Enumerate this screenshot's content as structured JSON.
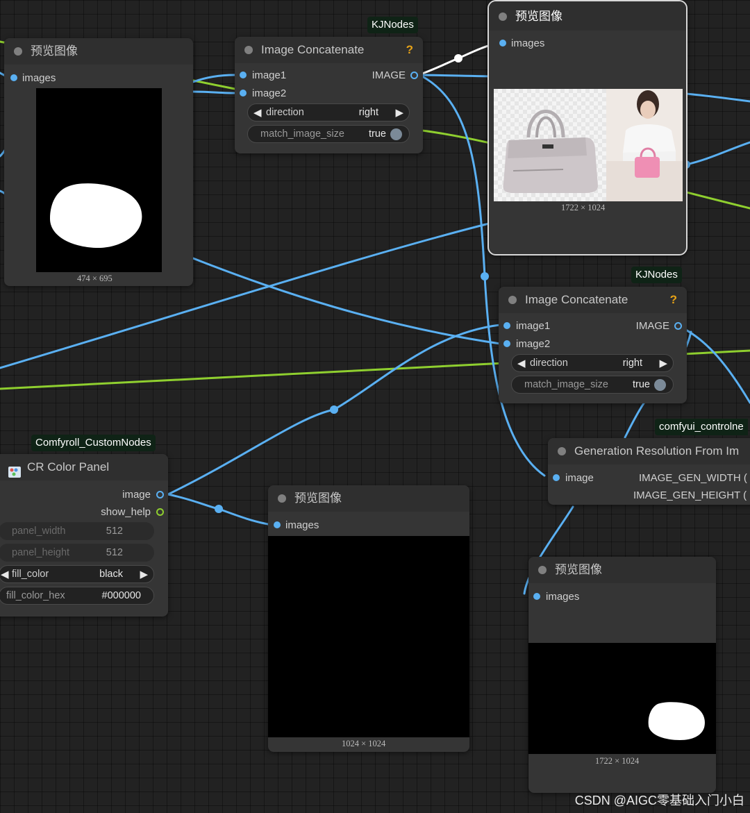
{
  "colors": {
    "canvas": "#222222",
    "node_body": "#353535",
    "node_title": "#2f2f2f",
    "image_link": "#5ab0f2",
    "green_link": "#8fcf2f",
    "help_icon": "#e8a317",
    "badge_bg": "#0f2316"
  },
  "icons": {
    "title_dot": "circle-dot-icon",
    "help": "question-mark-icon",
    "slot": "circle-connector-icon",
    "arrow_left": "triangle-left-icon",
    "arrow_right": "triangle-right-icon",
    "color_panel": "palette-icon"
  },
  "preview1": {
    "title": "预览图像",
    "input_label": "images",
    "dimensions": "474 × 695"
  },
  "concat1": {
    "badge": "KJNodes",
    "title": "Image Concatenate",
    "help": "?",
    "input1": "image1",
    "input2": "image2",
    "output": "IMAGE",
    "direction_label": "direction",
    "direction_value": "right",
    "match_label": "match_image_size",
    "match_value": "true"
  },
  "preview2": {
    "title": "预览图像",
    "input_label": "images",
    "dimensions": "1722 × 1024"
  },
  "concat2": {
    "badge": "KJNodes",
    "title": "Image Concatenate",
    "help": "?",
    "input1": "image1",
    "input2": "image2",
    "output": "IMAGE",
    "direction_label": "direction",
    "direction_value": "right",
    "match_label": "match_image_size",
    "match_value": "true"
  },
  "gen_res": {
    "badge": "comfyui_controlne",
    "title": "Generation Resolution From Im",
    "input": "image",
    "output1": "IMAGE_GEN_WIDTH (",
    "output2": "IMAGE_GEN_HEIGHT ("
  },
  "color_panel": {
    "badge": "Comfyroll_CustomNodes",
    "title": "CR Color Panel",
    "output1": "image",
    "output2": "show_help",
    "panel_width_label": "panel_width",
    "panel_width_value": "512",
    "panel_height_label": "panel_height",
    "panel_height_value": "512",
    "fill_color_label": "fill_color",
    "fill_color_value": "black",
    "fill_color_hex_label": "fill_color_hex",
    "fill_color_hex_value": "#000000"
  },
  "preview3": {
    "title": "预览图像",
    "input_label": "images",
    "dimensions": "1024 × 1024"
  },
  "preview4": {
    "title": "预览图像",
    "input_label": "images",
    "dimensions": "1722 × 1024"
  },
  "watermark": "CSDN @AIGC零基础入门小白"
}
